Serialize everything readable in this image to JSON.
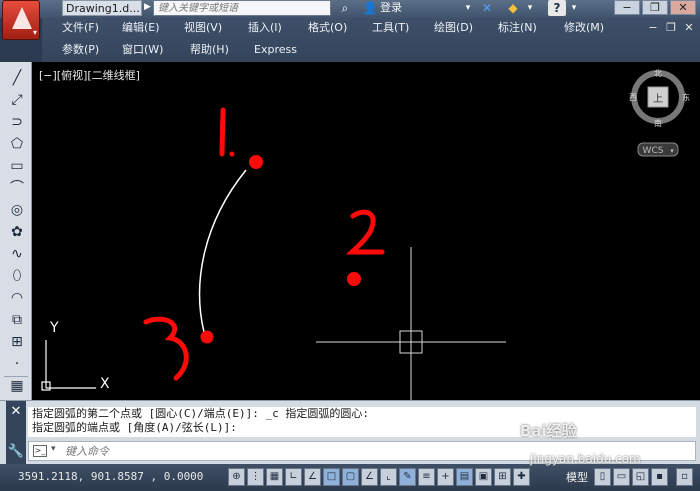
{
  "titlebar": {
    "doc_title": "Drawing1.d...",
    "search_placeholder": "键入关键字或短语",
    "login_label": "登录",
    "help_label": "?"
  },
  "menu": {
    "row1": [
      "文件(F)",
      "编辑(E)",
      "视图(V)",
      "插入(I)",
      "格式(O)",
      "工具(T)",
      "绘图(D)",
      "标注(N)",
      "修改(M)"
    ],
    "row2": [
      "参数(P)",
      "窗口(W)",
      "帮助(H)",
      "Express"
    ]
  },
  "canvas": {
    "view_label": "[−][俯视][二维线框]",
    "viewcube": {
      "north": "北",
      "south": "南",
      "east": "东",
      "west": "西",
      "top": "上",
      "wcs": "WCS"
    },
    "ucs": {
      "x": "X",
      "y": "Y"
    },
    "annotations": [
      "1",
      "2",
      "3"
    ]
  },
  "command": {
    "history_line1": "指定圆弧的第二个点或 [圆心(C)/端点(E)]: _c 指定圆弧的圆心:",
    "history_line2": "指定圆弧的端点或 [角度(A)/弦长(L)]:",
    "input_placeholder": "键入命令"
  },
  "status": {
    "coords": "3591.2118, 901.8587 , 0.0000",
    "model_label": "模型"
  },
  "watermark": {
    "brand": "Bai经验",
    "sub": "jingyan.baidu.com"
  },
  "colors": {
    "annotation_red": "#ff0a0a",
    "canvas_bg": "#000000"
  }
}
